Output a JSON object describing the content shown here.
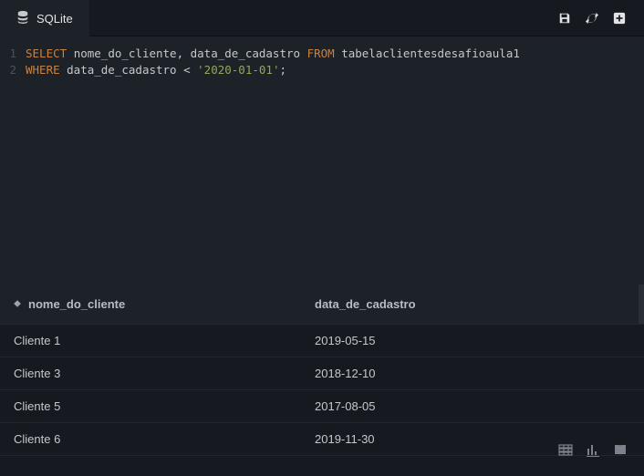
{
  "tab": {
    "label": "SQLite"
  },
  "code": {
    "lines": [
      {
        "num": "1",
        "tokens": [
          {
            "cls": "kw",
            "t": "SELECT "
          },
          {
            "cls": "",
            "t": "nome_do_cliente, data_de_cadastro "
          },
          {
            "cls": "kw",
            "t": "FROM "
          },
          {
            "cls": "",
            "t": "tabelaclientesdesafioaula1"
          }
        ]
      },
      {
        "num": "2",
        "tokens": [
          {
            "cls": "kw",
            "t": "WHERE "
          },
          {
            "cls": "",
            "t": "data_de_cadastro < "
          },
          {
            "cls": "str",
            "t": "'2020-01-01'"
          },
          {
            "cls": "",
            "t": ";"
          }
        ]
      }
    ]
  },
  "results": {
    "columns": [
      "nome_do_cliente",
      "data_de_cadastro"
    ],
    "rows": [
      {
        "a": "Cliente 1",
        "b": "2019-05-15"
      },
      {
        "a": "Cliente 3",
        "b": "2018-12-10"
      },
      {
        "a": "Cliente 5",
        "b": "2017-08-05"
      },
      {
        "a": "Cliente 6",
        "b": "2019-11-30"
      }
    ]
  }
}
